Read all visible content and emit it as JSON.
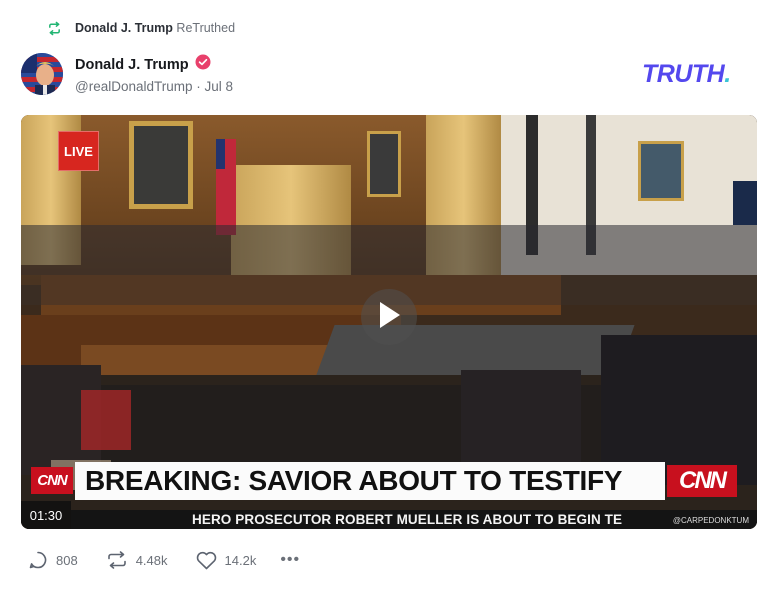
{
  "retruth": {
    "name": "Donald J. Trump",
    "action": "ReTruthed",
    "icon": "retruth-icon"
  },
  "post": {
    "display_name": "Donald J. Trump",
    "verified_icon": "verified-badge-icon",
    "handle": "@realDonaldTrump",
    "separator": "·",
    "date": "Jul 8"
  },
  "brand": {
    "logo_text": "TRUTH",
    "logo_dot": ".",
    "color": "#5448ee",
    "dot_color": "#39c4d6"
  },
  "video": {
    "live_badge": "LIVE",
    "cnn_left": "CNN",
    "headline": "BREAKING: SAVIOR ABOUT TO TESTIFY",
    "cnn_right": "CNN",
    "duration": "01:30",
    "ticker": "HERO PROSECUTOR ROBERT MUELLER IS ABOUT TO BEGIN TE",
    "watermark": "@CARPEDONKTUM",
    "play_icon": "play-icon"
  },
  "actions": {
    "replies": "808",
    "retruths": "4.48k",
    "likes": "14.2k",
    "more": "•••"
  }
}
